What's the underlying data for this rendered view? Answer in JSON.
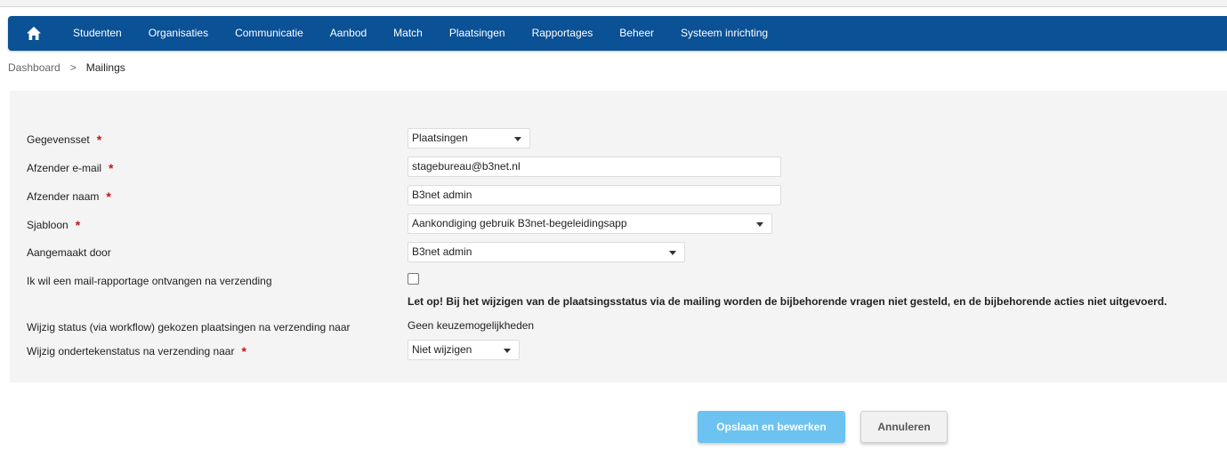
{
  "nav": {
    "home_icon": "home-icon",
    "items": [
      "Studenten",
      "Organisaties",
      "Communicatie",
      "Aanbod",
      "Match",
      "Plaatsingen",
      "Rapportages",
      "Beheer",
      "Systeem inrichting"
    ]
  },
  "breadcrumb": {
    "root": "Dashboard",
    "separator": ">",
    "current": "Mailings"
  },
  "form": {
    "required_marker": "*",
    "dataset": {
      "label": "Gegevensset",
      "value": "Plaatsingen"
    },
    "sender_email": {
      "label": "Afzender e-mail",
      "value": "stagebureau@b3net.nl"
    },
    "sender_name": {
      "label": "Afzender naam",
      "value": "B3net admin"
    },
    "template": {
      "label": "Sjabloon",
      "value": "Aankondiging gebruik B3net-begeleidingsapp"
    },
    "created_by": {
      "label": "Aangemaakt door",
      "value": "B3net admin"
    },
    "report": {
      "label": "Ik wil een mail-rapportage ontvangen na verzending",
      "checked": false
    },
    "warning": "Let op! Bij het wijzigen van de plaatsingsstatus via de mailing worden de bijbehorende vragen niet gesteld, en de bijbehorende acties niet uitgevoerd.",
    "status_change": {
      "label": "Wijzig status (via workflow) gekozen plaatsingen na verzending naar",
      "value": "Geen keuzemogelijkheden"
    },
    "sign_status": {
      "label": "Wijzig ondertekenstatus na verzending naar",
      "value": "Niet wijzigen"
    }
  },
  "actions": {
    "save_label": "Opslaan en bewerken",
    "cancel_label": "Annuleren"
  },
  "colors": {
    "navbar": "#0a5196",
    "save_button": "#6cc2f0",
    "required": "#c81414",
    "panel": "#f4f4f4"
  }
}
